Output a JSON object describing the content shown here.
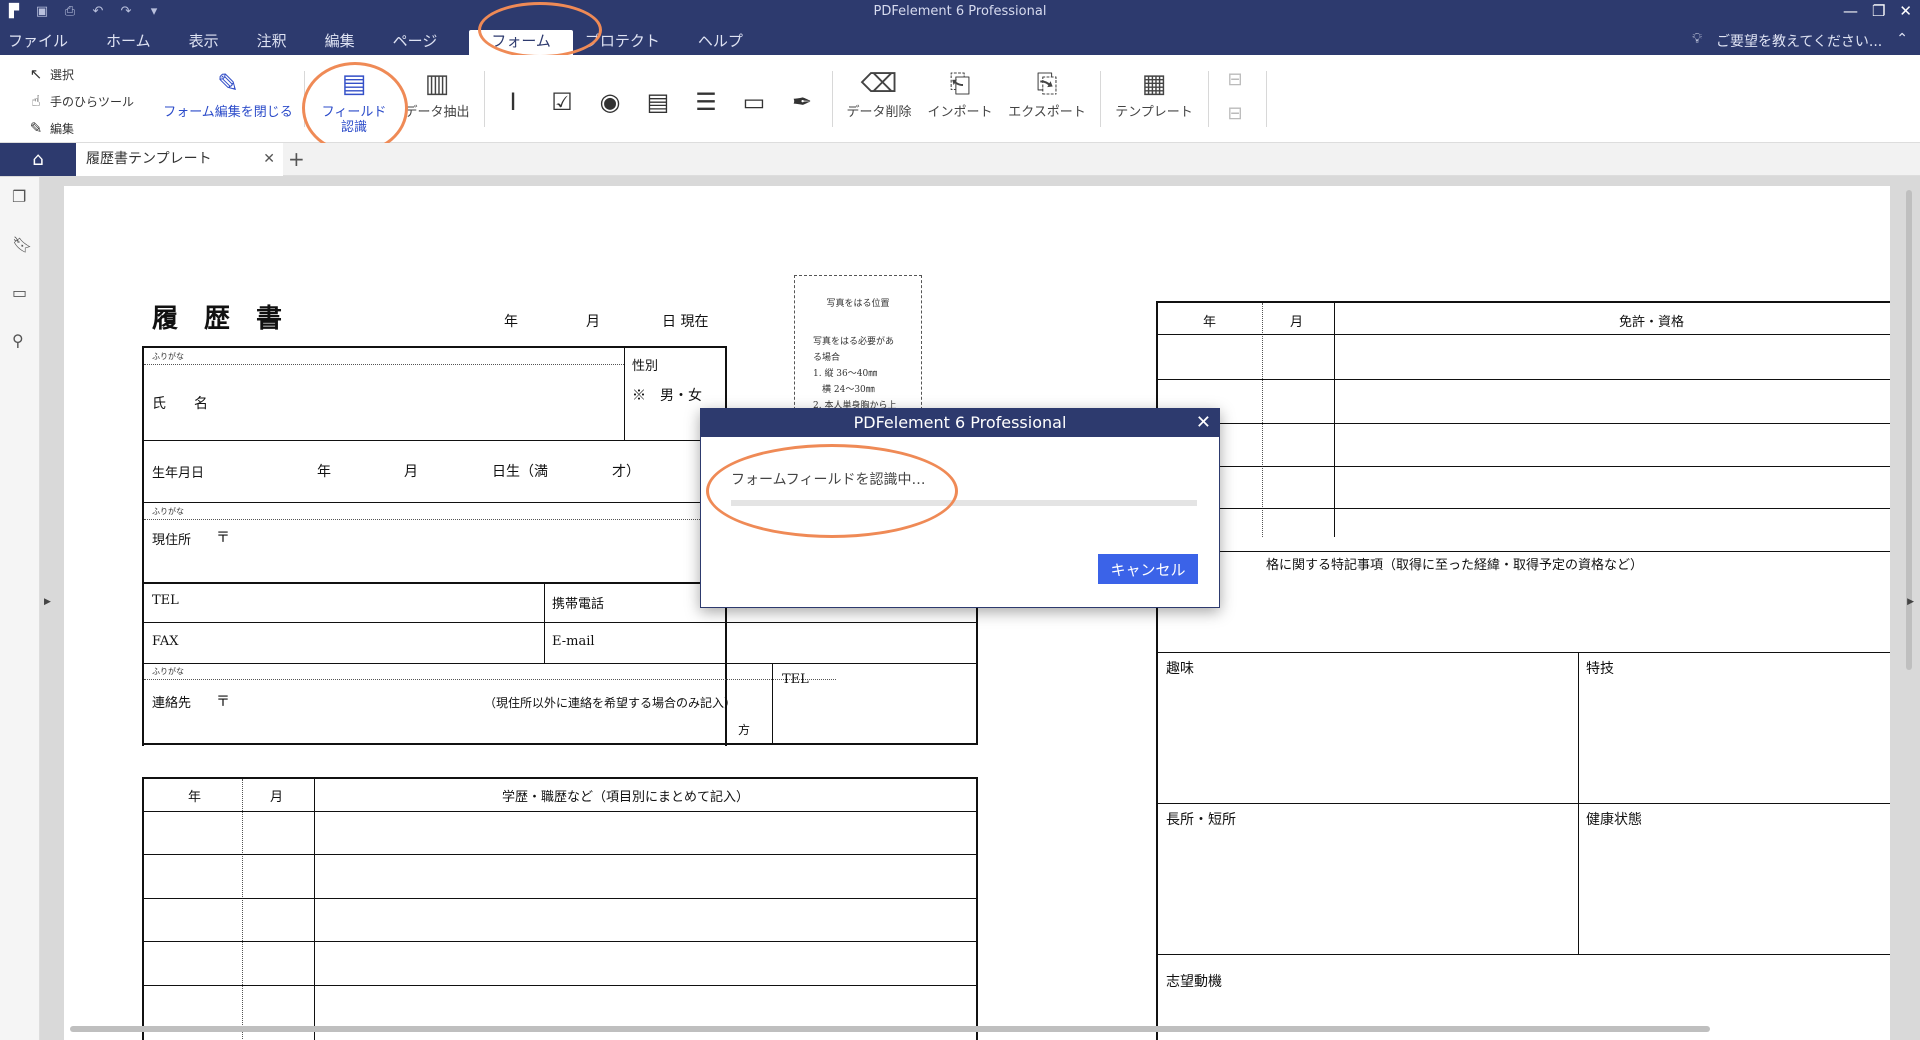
{
  "app": {
    "title": "PDFelement 6 Professional",
    "accent": "#2d3a6e",
    "highlight_ring_color": "#ef8a56"
  },
  "quick_access": [
    "app-logo-icon",
    "save-icon",
    "print-icon",
    "undo-icon",
    "redo-icon",
    "customize-icon"
  ],
  "window_controls": [
    "minimize-icon",
    "restore-icon",
    "close-icon"
  ],
  "menu": {
    "items": [
      "ファイル",
      "ホーム",
      "表示",
      "注釈",
      "編集",
      "ページ",
      "フォーム",
      "プロテクト",
      "ヘルプ"
    ],
    "active": "フォーム"
  },
  "help_search": {
    "placeholder": "ご要望を教えてください...",
    "icon": "lightbulb-icon"
  },
  "ribbon": {
    "select": "選択",
    "hand_tool": "手のひらツール",
    "edit": "編集",
    "close_form_edit": "フォーム編集を閉じる",
    "field_recognition": "フィールド\n認識",
    "data_extract": "データ抽出",
    "form_tools": [
      "text-field-icon",
      "checkbox-icon",
      "radio-button-icon",
      "combo-box-icon",
      "list-box-icon",
      "button-field-icon",
      "signature-field-icon"
    ],
    "clear_data": "データ削除",
    "import": "インポート",
    "export": "エクスポート",
    "template": "テンプレート"
  },
  "tabs": {
    "document": "履歴書テンプレート",
    "new_tab": "+"
  },
  "document": {
    "title": "履　歴　書",
    "date_line": [
      "年",
      "月",
      "日 現在"
    ],
    "furigana": "ふりがな",
    "gender_label": "性別",
    "gender_value": "※　男・女",
    "name_label": "氏　　名",
    "birth_label": "生年月日",
    "birth_units": [
      "年",
      "月",
      "日生（満",
      "才）"
    ],
    "address_label": "現住所",
    "postal_mark": "〒",
    "tel_label": "TEL",
    "mobile_label": "携帯電話",
    "fax_label": "FAX",
    "email_label": "E-mail",
    "contact_label": "連絡先",
    "contact_note": "（現住所以外に連絡を希望する場合のみ記入）",
    "contact_suffix": "方",
    "contact_tel": "TEL",
    "edu_headers": [
      "年",
      "月",
      "学歴・職歴など（項目別にまとめて記入）"
    ],
    "photo_title": "写真をはる位置",
    "photo_lines": [
      "写真をはる必要があ",
      "る場合",
      "1. 縦 36〜40㎜",
      "　横 24〜30㎜",
      "2. 本人単身胸から上"
    ],
    "license_headers": [
      "年",
      "月",
      "免許・資格"
    ],
    "special_notes": "格に関する特記事項（取得に至った経緯・取得予定の資格など）",
    "hobby": "趣味",
    "skill": "特技",
    "strengths": "長所・短所",
    "health": "健康状態",
    "motivation": "志望動機"
  },
  "dialog": {
    "title": "PDFelement 6 Professional",
    "message": "フォームフィールドを認識中…",
    "progress": 0.0,
    "cancel": "キャンセル"
  }
}
